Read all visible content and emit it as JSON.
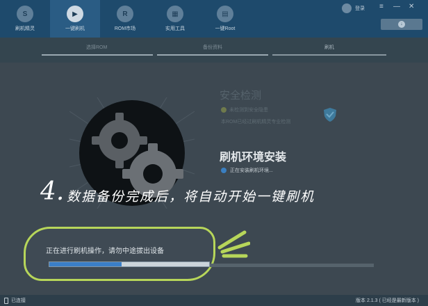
{
  "nav": {
    "items": [
      {
        "label": "刷机精灵",
        "icon": "shield-s-icon",
        "glyph": "S"
      },
      {
        "label": "一键刷机",
        "icon": "play-icon",
        "glyph": "▶"
      },
      {
        "label": "ROM市场",
        "icon": "rom-market-icon",
        "glyph": "R"
      },
      {
        "label": "实用工具",
        "icon": "tools-grid-icon",
        "glyph": "▦"
      },
      {
        "label": "一键Root",
        "icon": "root-car-icon",
        "glyph": "▤"
      }
    ],
    "active_index": 1
  },
  "user": {
    "login_label": "登录"
  },
  "window": {
    "menu_glyph": "≡",
    "min_glyph": "—",
    "close_glyph": "✕"
  },
  "steps": {
    "items": [
      {
        "label": "选择ROM",
        "state": "done"
      },
      {
        "label": "备份资料",
        "state": "done"
      },
      {
        "label": "刷机",
        "state": "current"
      }
    ]
  },
  "safety": {
    "title": "安全检测",
    "line1": "未检测到安全隐患",
    "line2": "本ROM已经过刷机精灵专业检测"
  },
  "env": {
    "title": "刷机环境安装",
    "status": "正在安装刷机环境..."
  },
  "tutorial": {
    "step_number": "4.",
    "caption": "数据备份完成后，将自动开始一键刷机"
  },
  "callout": {
    "text": "正在进行刷机操作，请勿中途拔出设备",
    "progress_fraction": 0.45
  },
  "statusbar": {
    "connection": "已连接",
    "version": "版本 2.1.3 ( 已经是最新版本 )"
  },
  "colors": {
    "topbar": "#1e4a6c",
    "accent_blue": "#3a7fc8",
    "callout_border": "#b7d65a",
    "panel": "#3d4851"
  }
}
